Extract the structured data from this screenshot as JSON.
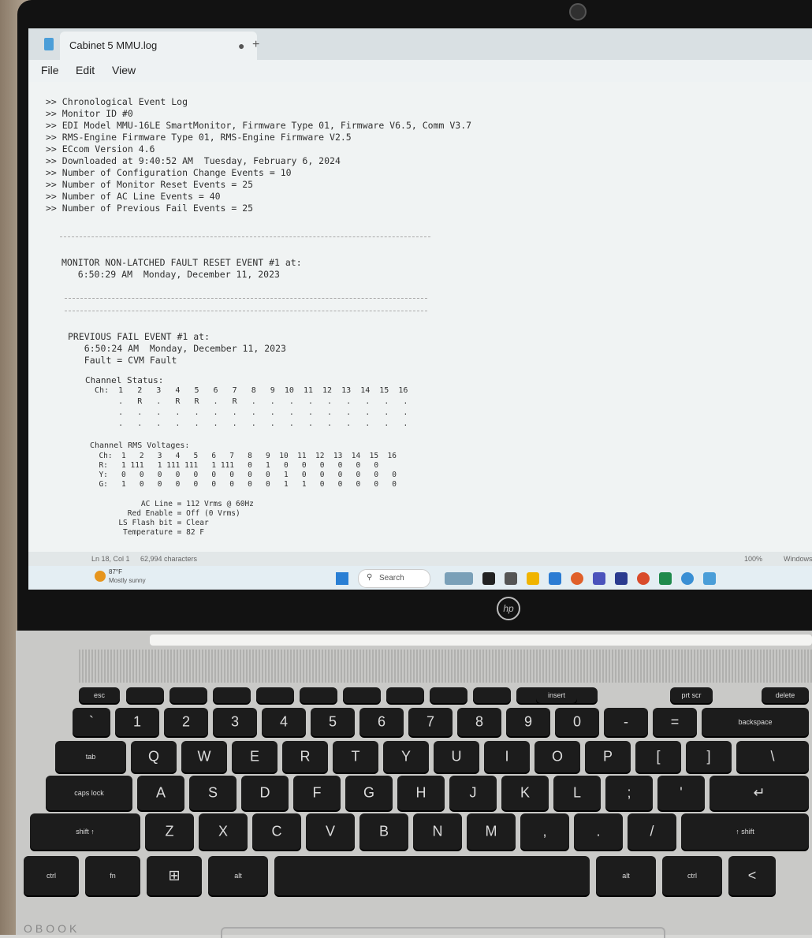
{
  "window": {
    "tab_title": "Cabinet 5 MMU.log",
    "tab_modified": "●",
    "new_tab": "+"
  },
  "menu": [
    "File",
    "Edit",
    "View"
  ],
  "log": {
    "header": [
      ">> Chronological Event Log",
      ">> Monitor ID #0",
      ">> EDI Model MMU-16LE SmartMonitor, Firmware Type 01, Firmware V6.5, Comm V3.7",
      ">> RMS-Engine Firmware Type 01, RMS-Engine Firmware V2.5",
      ">> ECcom Version 4.6",
      ">> Downloaded at 9:40:52 AM  Tuesday, February 6, 2024",
      ">> Number of Configuration Change Events = 10",
      ">> Number of Monitor Reset Events = 25",
      ">> Number of AC Line Events = 40",
      ">> Number of Previous Fail Events = 25"
    ],
    "reset_event": [
      "MONITOR NON-LATCHED FAULT RESET EVENT #1 at:",
      "   6:50:29 AM  Monday, December 11, 2023"
    ],
    "fail_event": [
      "PREVIOUS FAIL EVENT #1 at:",
      "   6:50:24 AM  Monday, December 11, 2023",
      "   Fault = CVM Fault"
    ],
    "channel_status": [
      "Channel Status:",
      "  Ch:  1   2   3   4   5   6   7   8   9  10  11  12  13  14  15  16",
      "       .   R   .   R   R   .   R   .   .   .   .   .   .   .   .   .",
      "       .   .   .   .   .   .   .   .   .   .   .   .   .   .   .   .",
      "       .   .   .   .   .   .   .   .   .   .   .   .   .   .   .   ."
    ],
    "rms": [
      "Channel RMS Voltages:",
      "  Ch:  1   2   3   4   5   6   7   8   9  10  11  12  13  14  15  16",
      "  R:   1 111   1 111 111   1 111   0   1   0   0   0   0   0   0",
      "  Y:   0   0   0   0   0   0   0   0   0   1   0   0   0   0   0   0",
      "  G:   1   0   0   0   0   0   0   0   0   1   1   0   0   0   0   0"
    ],
    "ac": [
      "           AC Line = 112 Vrms @ 60Hz",
      "        Red Enable = Off (0 Vrms)",
      "      LS Flash bit = Clear",
      "       Temperature = 82 F"
    ]
  },
  "status": {
    "position": "Ln 18, Col 1",
    "chars": "62,994 characters",
    "zoom": "100%",
    "eol": "Windows"
  },
  "taskbar": {
    "temp": "87°F",
    "condition": "Mostly sunny",
    "search": "Search"
  },
  "laptop": {
    "logo": "hp",
    "brand": "OBOOK"
  },
  "keyboard": {
    "fn_row": [
      "esc",
      "",
      "",
      "",
      "",
      "",
      "",
      "",
      "",
      "",
      "",
      "",
      "insert",
      "",
      "",
      "prt scr",
      "",
      "delete"
    ],
    "num_row": [
      "`",
      "1",
      "2",
      "3",
      "4",
      "5",
      "6",
      "7",
      "8",
      "9",
      "0",
      "-",
      "=",
      "backspace"
    ],
    "q_row": [
      "tab",
      "Q",
      "W",
      "E",
      "R",
      "T",
      "Y",
      "U",
      "I",
      "O",
      "P",
      "[",
      "]",
      "\\"
    ],
    "a_row": [
      "caps lock",
      "A",
      "S",
      "D",
      "F",
      "G",
      "H",
      "J",
      "K",
      "L",
      ";",
      "'",
      "↵"
    ],
    "z_row": [
      "shift ↑",
      "Z",
      "X",
      "C",
      "V",
      "B",
      "N",
      "M",
      ",",
      ".",
      "/",
      "↑ shift"
    ],
    "bottom_row": [
      "ctrl",
      "fn",
      "⊞",
      "alt",
      "",
      "alt",
      "ctrl",
      "<"
    ]
  }
}
